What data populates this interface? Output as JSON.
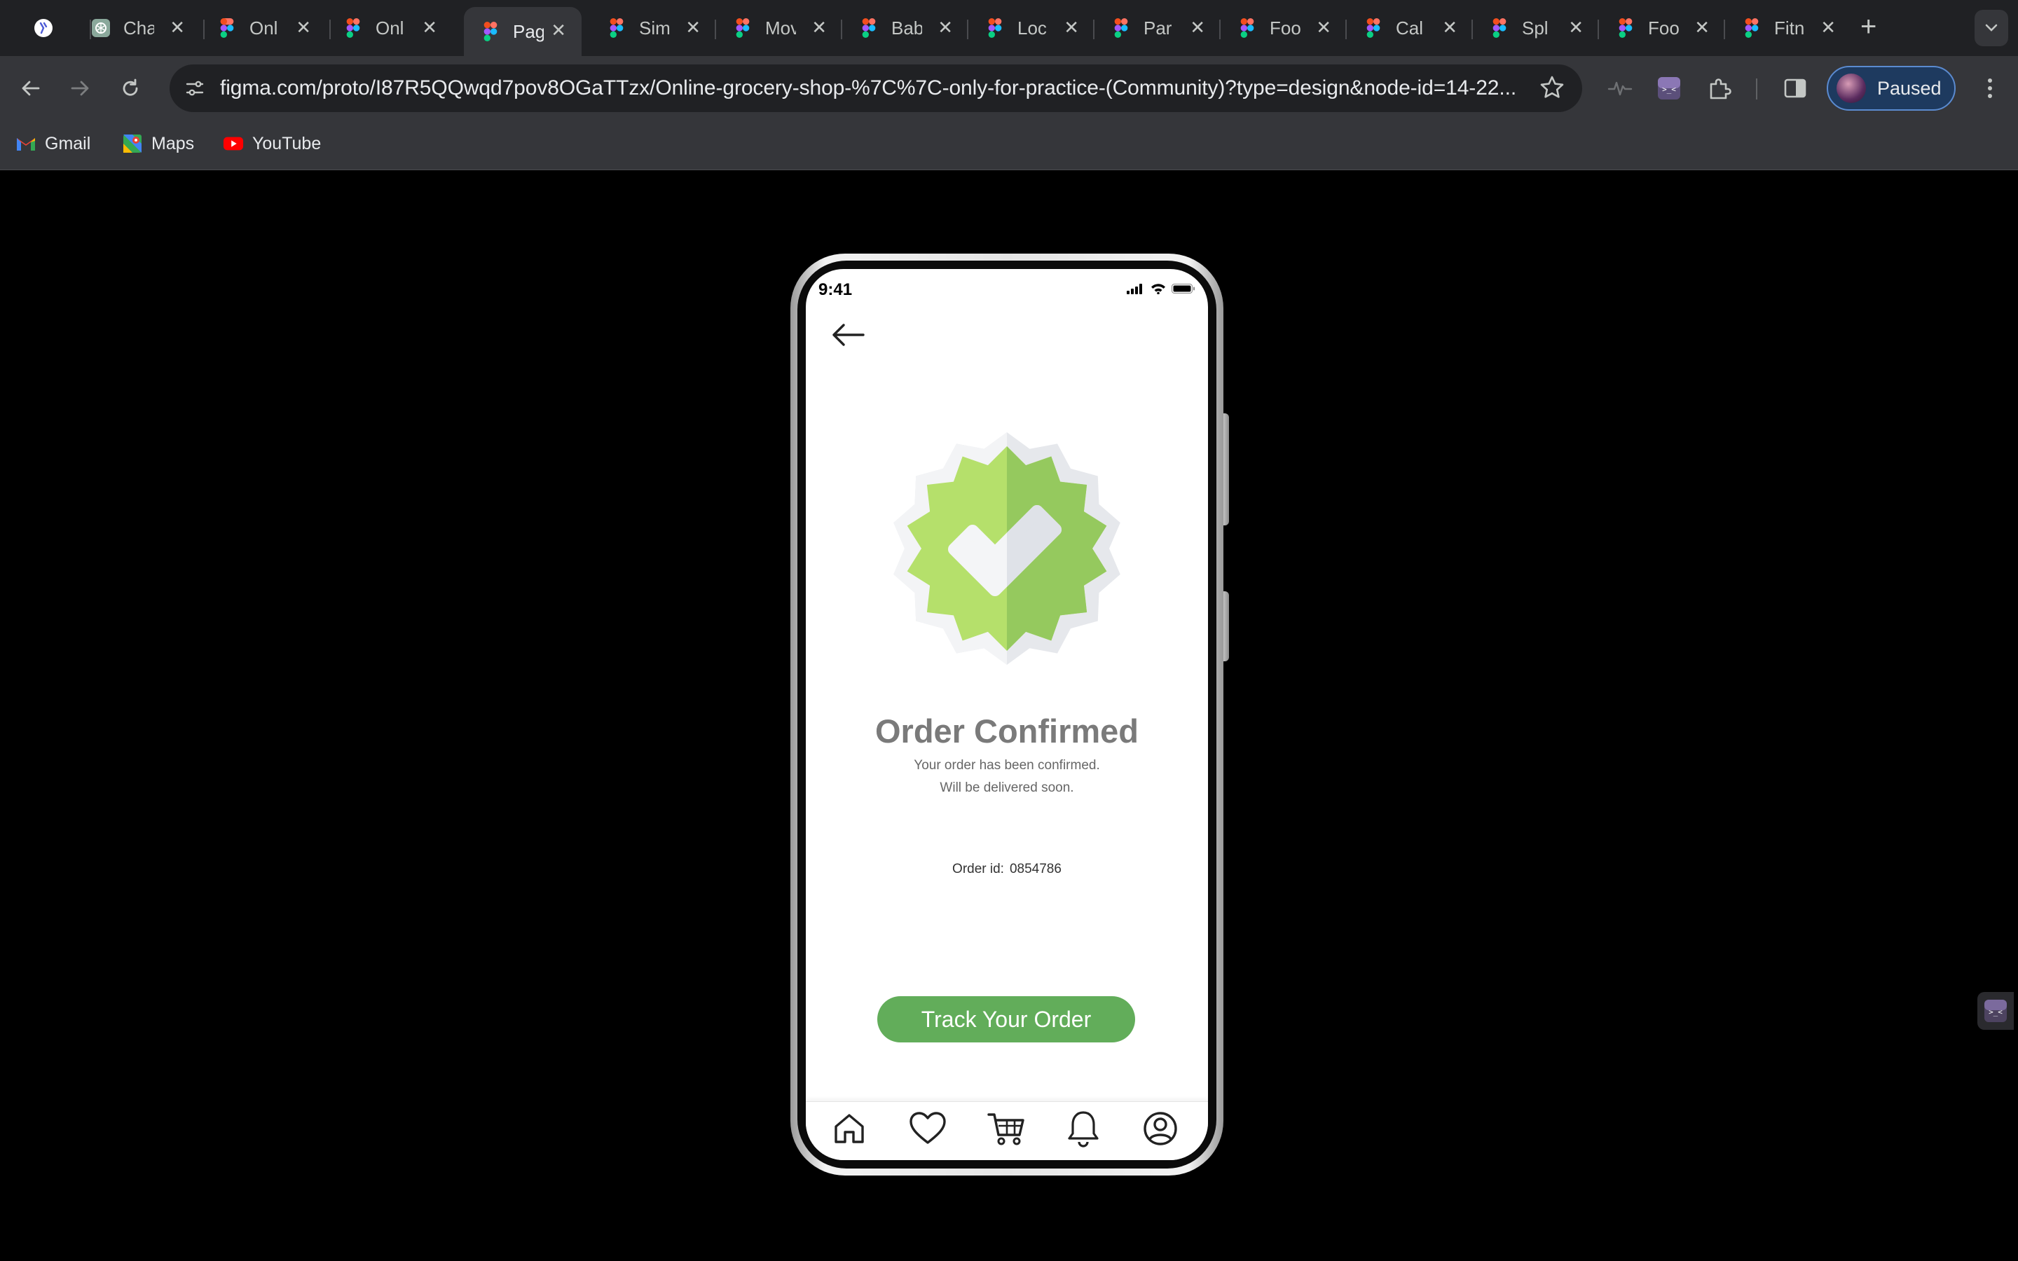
{
  "browser": {
    "tabs": [
      {
        "title": "",
        "icon": "app-icon"
      },
      {
        "title": "Cha",
        "icon": "chatgpt-icon"
      },
      {
        "title": "Onl",
        "icon": "figma-icon"
      },
      {
        "title": "Onl",
        "icon": "figma-icon"
      },
      {
        "title": "Pag",
        "icon": "figma-icon",
        "active": true
      },
      {
        "title": "Sim",
        "icon": "figma-icon"
      },
      {
        "title": "Mov",
        "icon": "figma-icon"
      },
      {
        "title": "Bab",
        "icon": "figma-icon"
      },
      {
        "title": "Loc",
        "icon": "figma-icon"
      },
      {
        "title": "Par",
        "icon": "figma-icon"
      },
      {
        "title": "Foo",
        "icon": "figma-icon"
      },
      {
        "title": "Cal",
        "icon": "figma-icon"
      },
      {
        "title": "Spl",
        "icon": "figma-icon"
      },
      {
        "title": "Foo",
        "icon": "figma-icon"
      },
      {
        "title": "Fitn",
        "icon": "figma-icon"
      }
    ],
    "url": "figma.com/proto/I87R5QQwqd7pov8OGaTTzx/Online-grocery-shop-%7C%7C-only-for-practice-(Community)?type=design&node-id=14-22...",
    "profile_label": "Paused",
    "bookmarks": [
      {
        "label": "Gmail",
        "icon": "gmail-icon"
      },
      {
        "label": "Maps",
        "icon": "maps-icon"
      },
      {
        "label": "YouTube",
        "icon": "youtube-icon"
      }
    ]
  },
  "app": {
    "status_time": "9:41",
    "title": "Order Confirmed",
    "subtitle_line1": "Your order has been confirmed.",
    "subtitle_line2": "Will be delivered soon.",
    "order_id_label": "Order id:",
    "order_id_value": "0854786",
    "track_button": "Track Your Order",
    "accent_color": "#62ad5a",
    "nav_items": [
      "home-icon",
      "heart-icon",
      "cart-icon",
      "bell-icon",
      "profile-icon"
    ]
  }
}
